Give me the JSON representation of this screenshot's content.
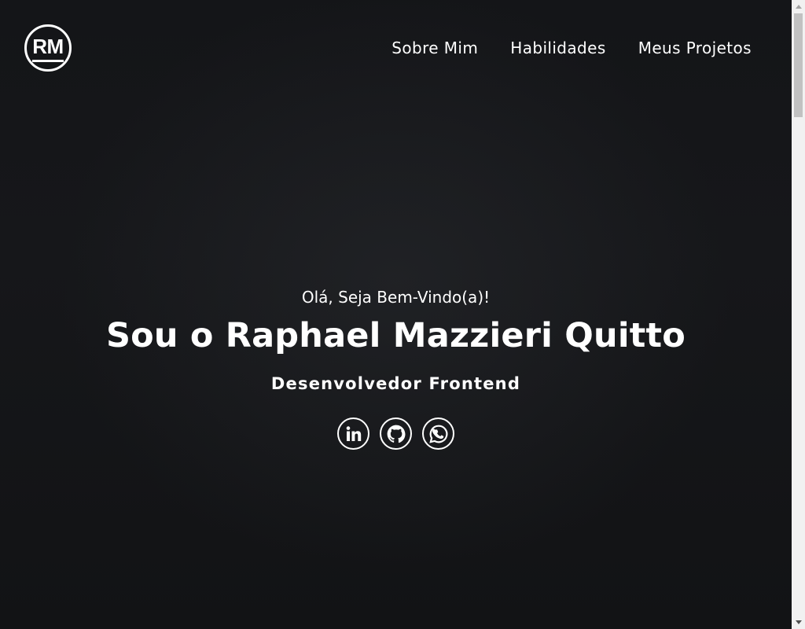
{
  "header": {
    "logo_text": "RM",
    "nav": [
      {
        "label": "Sobre Mim"
      },
      {
        "label": "Habilidades"
      },
      {
        "label": "Meus Projetos"
      }
    ]
  },
  "hero": {
    "greeting": "Olá, Seja Bem-Vindo(a)!",
    "name": "Sou o Raphael Mazzieri Quitto",
    "role": "Desenvolvedor Frontend",
    "socials": [
      {
        "icon": "linkedin-icon"
      },
      {
        "icon": "github-icon"
      },
      {
        "icon": "whatsapp-icon"
      }
    ]
  },
  "colors": {
    "background": "#111214",
    "text": "#ffffff"
  }
}
